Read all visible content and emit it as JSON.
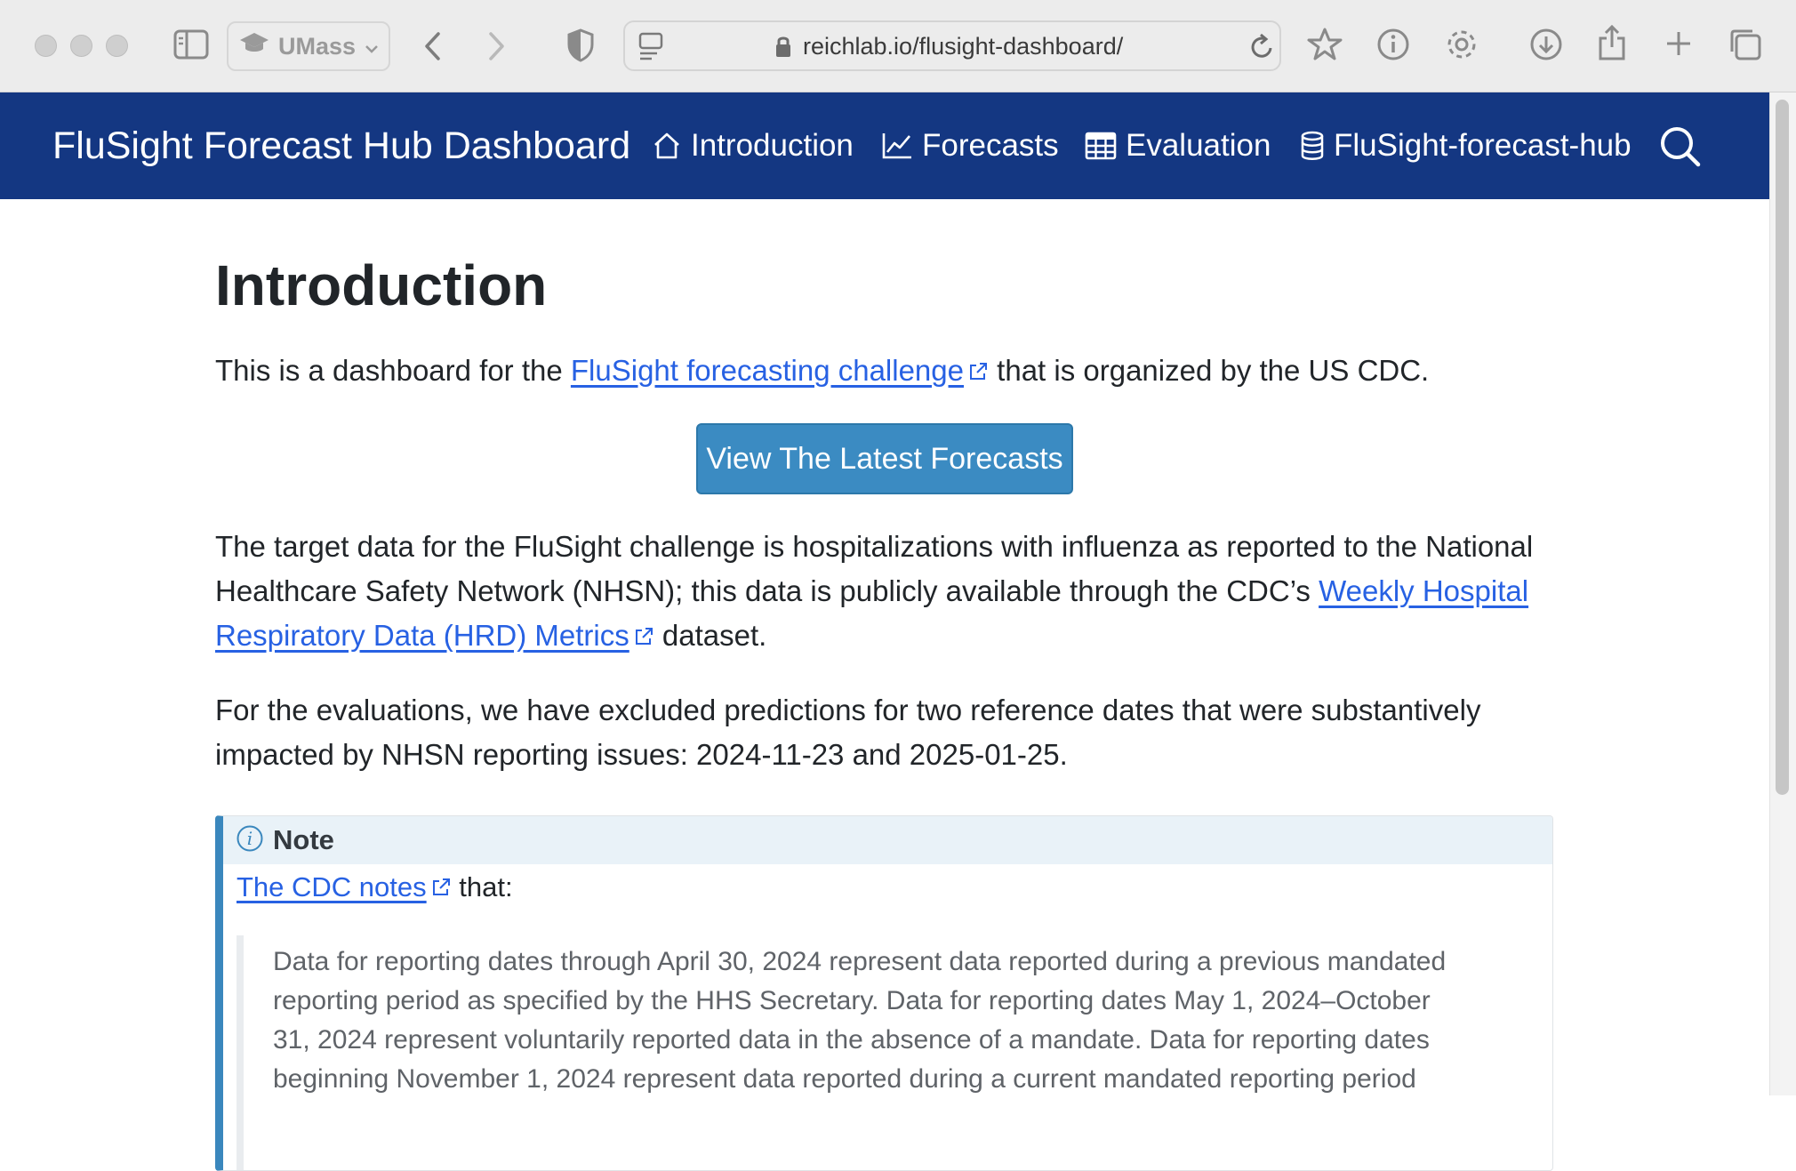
{
  "browser": {
    "profile_label": "UMass",
    "url": "reichlab.io/flusight-dashboard/"
  },
  "navbar": {
    "brand": "FluSight Forecast Hub Dashboard",
    "items": [
      {
        "label": "Introduction",
        "icon": "house-icon"
      },
      {
        "label": "Forecasts",
        "icon": "line-chart-icon"
      },
      {
        "label": "Evaluation",
        "icon": "table-icon"
      },
      {
        "label": "FluSight-forecast-hub",
        "icon": "database-icon"
      }
    ],
    "search_icon": "search-icon",
    "bg_color": "#143782"
  },
  "main": {
    "title": "Introduction",
    "intro": {
      "before": "This is a dashboard for the ",
      "link": "FluSight forecasting challenge",
      "after": " that is organized by the US CDC."
    },
    "cta_button": "View The Latest Forecasts",
    "target": {
      "text": "The target data for the FluSight challenge is hospitalizations with influenza as reported to the National Healthcare Safety Network (NHSN); this data is publicly available through the CDC’s ",
      "link": "Weekly Hospital Respiratory Data (HRD) Metrics",
      "after": " dataset."
    },
    "evaluations": "For the evaluations, we have excluded predictions for two reference dates that were substantively impacted by NHSN reporting issues: 2024-11-23 and 2025-01-25.",
    "note": {
      "title": "Note",
      "link": "The CDC notes",
      "after": " that:",
      "quote_lines": [
        "Data for reporting dates through April 30, 2024 represent data reported during a previous mandated",
        "reporting period as specified by the HHS Secretary. Data for reporting dates May 1, 2024–October",
        "31, 2024 represent voluntarily reported data in the absence of a mandate. Data for reporting dates",
        "beginning November 1, 2024 represent data reported during a current mandated reporting period"
      ]
    }
  },
  "colors": {
    "link": "#2761e3",
    "button": "#3b8bc2",
    "callout_accent": "#3a87bd"
  }
}
